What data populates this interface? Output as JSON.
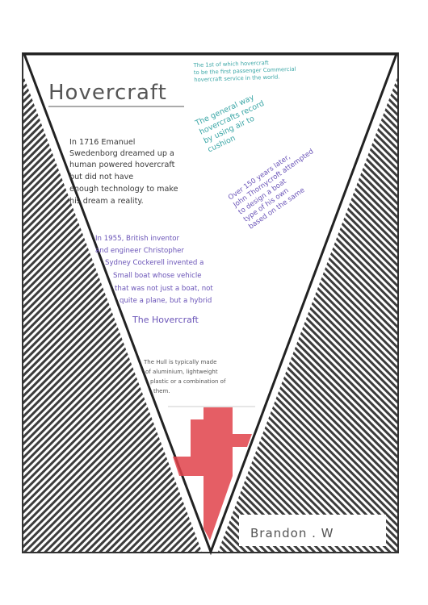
{
  "title": "Hovercraft",
  "paragraph_1": [
    "In 1716 Emanuel",
    "Swedenborg dreamed up a",
    "human powered hovercraft",
    "but did not have",
    "enough technology to make",
    "his dream a reality."
  ],
  "paragraph_2": [
    "In 1955, British inventor",
    "and engineer Christopher",
    "Sydney Cockerell invented a",
    "Small boat whose vehicle",
    "that was not just a boat, not",
    "quite a plane, but a hybrid"
  ],
  "paragraph_2_last": "The Hovercraft",
  "note_top": [
    "The 1st of which hovercraft",
    "to be the first passenger Commercial",
    "hovercraft service in the world."
  ],
  "note_diagonal_1": [
    "The general way",
    "hovercrafts record",
    "by using air to",
    "cushion"
  ],
  "note_diagonal_2": [
    "Over 150 years later,",
    "John Thornycroft attempted",
    "to design a boat",
    "type of his own",
    "based on the same"
  ],
  "paragraph_3": [
    "The Hull is typically made",
    "of aluminium, lightweight",
    "plastic or a combination of",
    "them."
  ],
  "author_name": "Brandon . W",
  "colors": {
    "stripe": "#3c3c3c",
    "cross": "#e0424a",
    "frame": "#333333",
    "dark_text": "#3a3a3a",
    "purple_text": "#6b55b8",
    "teal_text": "#3aa6a6"
  },
  "icons": [
    "red-cross-flag-icon"
  ]
}
